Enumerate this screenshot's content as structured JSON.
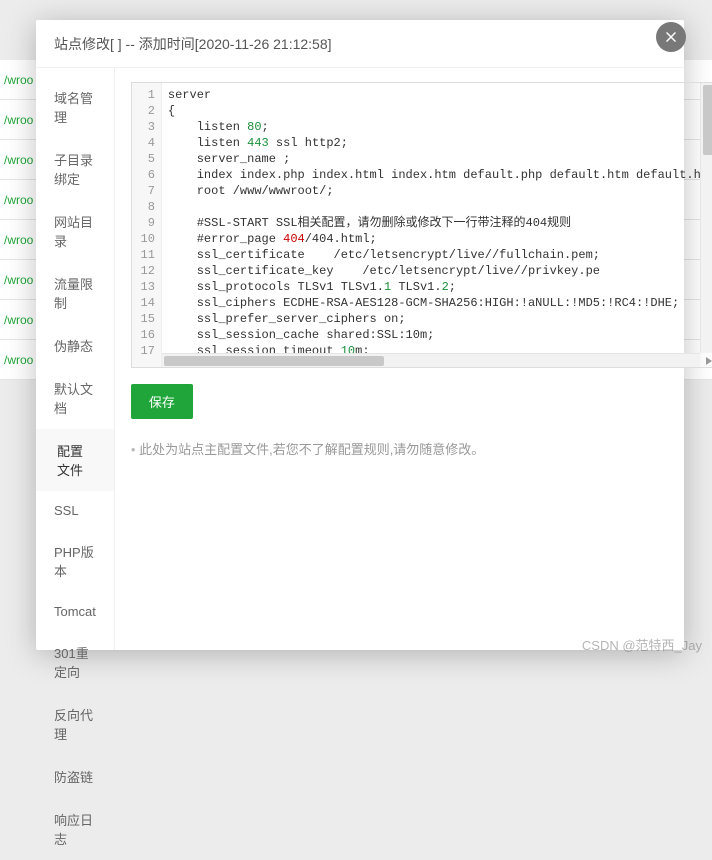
{
  "header": {
    "title": "站点修改[                           ] -- 添加时间[2020-11-26 21:12:58]"
  },
  "sidebar": {
    "items": [
      {
        "label": "域名管理",
        "key": "domain"
      },
      {
        "label": "子目录绑定",
        "key": "subdir"
      },
      {
        "label": "网站目录",
        "key": "sitedir"
      },
      {
        "label": "流量限制",
        "key": "traffic"
      },
      {
        "label": "伪静态",
        "key": "rewrite"
      },
      {
        "label": "默认文档",
        "key": "defaultdoc"
      },
      {
        "label": "配置文件",
        "key": "config",
        "active": true
      },
      {
        "label": "SSL",
        "key": "ssl"
      },
      {
        "label": "PHP版本",
        "key": "php"
      },
      {
        "label": "Tomcat",
        "key": "tomcat"
      },
      {
        "label": "301重定向",
        "key": "redirect"
      },
      {
        "label": "反向代理",
        "key": "proxy"
      },
      {
        "label": "防盗链",
        "key": "antileech"
      },
      {
        "label": "响应日志",
        "key": "log"
      }
    ]
  },
  "editor": {
    "lines": [
      {
        "n": 1,
        "text": "server"
      },
      {
        "n": 2,
        "text": "{"
      },
      {
        "n": 3,
        "text": "    listen ",
        "num": "80",
        "after": ";"
      },
      {
        "n": 4,
        "text": "    listen ",
        "num": "443",
        "after": " ssl http2;"
      },
      {
        "n": 5,
        "text": "    server_name ",
        "after": ";"
      },
      {
        "n": 6,
        "text": "    index index.php index.html index.htm default.php default.htm default.ht"
      },
      {
        "n": 7,
        "text": "    root /www/wwwroot/",
        "after": ";"
      },
      {
        "n": 8,
        "text": ""
      },
      {
        "n": 9,
        "text": "    #SSL-START SSL相关配置，请勿删除或修改下一行带注释的404规则"
      },
      {
        "n": 10,
        "text": "    #error_page ",
        "err": "404",
        "after2": "/404.html;"
      },
      {
        "n": 11,
        "text": "    ssl_certificate    /etc/letsencrypt/live/",
        "after": "/fullchain.pem;"
      },
      {
        "n": 12,
        "text": "    ssl_certificate_key    /etc/letsencrypt/live/",
        "after": "/privkey.pe"
      },
      {
        "n": 13,
        "text": "    ssl_protocols TLSv1 TLSv1.",
        "num": "1",
        "mid": " TLSv1.",
        "num2": "2",
        "after": ";"
      },
      {
        "n": 14,
        "text": "    ssl_ciphers ECDHE-RSA-AES128-GCM-SHA256:HIGH:!aNULL:!MD5:!RC4:!DHE;"
      },
      {
        "n": 15,
        "text": "    ssl_prefer_server_ciphers on;"
      },
      {
        "n": 16,
        "text": "    ssl_session_cache shared:SSL:10m;"
      },
      {
        "n": 17,
        "text": "    ssl_session_timeout ",
        "num": "10",
        "after": "m;"
      }
    ]
  },
  "buttons": {
    "save": "保存"
  },
  "note": "此处为站点主配置文件,若您不了解配置规则,请勿随意修改。",
  "watermark": "CSDN @范特西_Jay",
  "bg_label": "/wroo"
}
